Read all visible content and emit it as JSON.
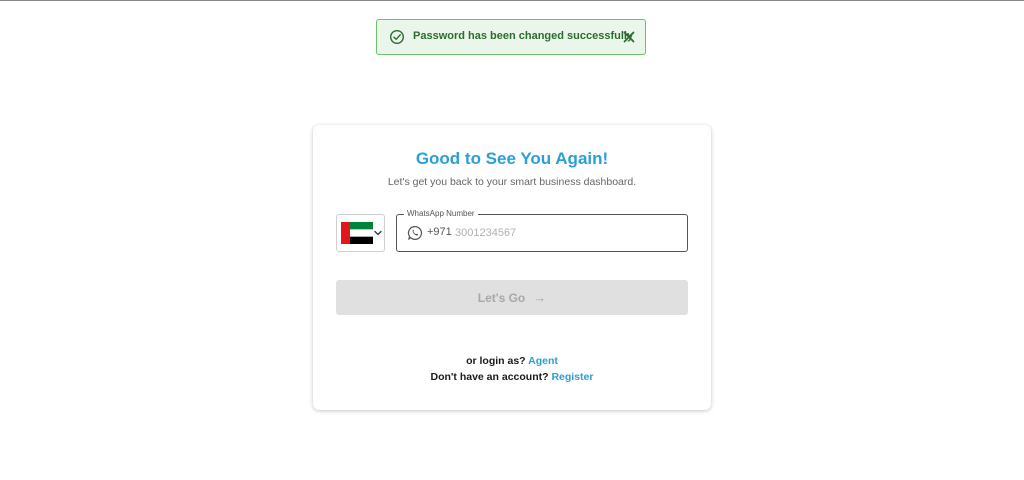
{
  "toast": {
    "message": "Password has been changed successfully",
    "icon": "check-circle-icon",
    "close_icon": "close-icon",
    "color": "#2e6b30",
    "background": "#eaf6ea"
  },
  "login_card": {
    "title": "Good to See You Again!",
    "subtitle": "Let's get you back to your smart business dashboard.",
    "accent_color": "#2b9fd6",
    "country_select": {
      "selected_flag": "uae-flag-icon",
      "chevron": "chevron-down-icon"
    },
    "phone_field": {
      "label": "WhatsApp Number",
      "icon": "whatsapp-icon",
      "dial_code": "+971",
      "value": "",
      "placeholder": "3001234567"
    },
    "submit_button": {
      "label": "Let's Go",
      "arrow": "→",
      "disabled": true
    },
    "agent_prompt": "or login as?",
    "agent_link": "Agent",
    "register_prompt": "Don't have an account?",
    "register_link": "Register"
  }
}
